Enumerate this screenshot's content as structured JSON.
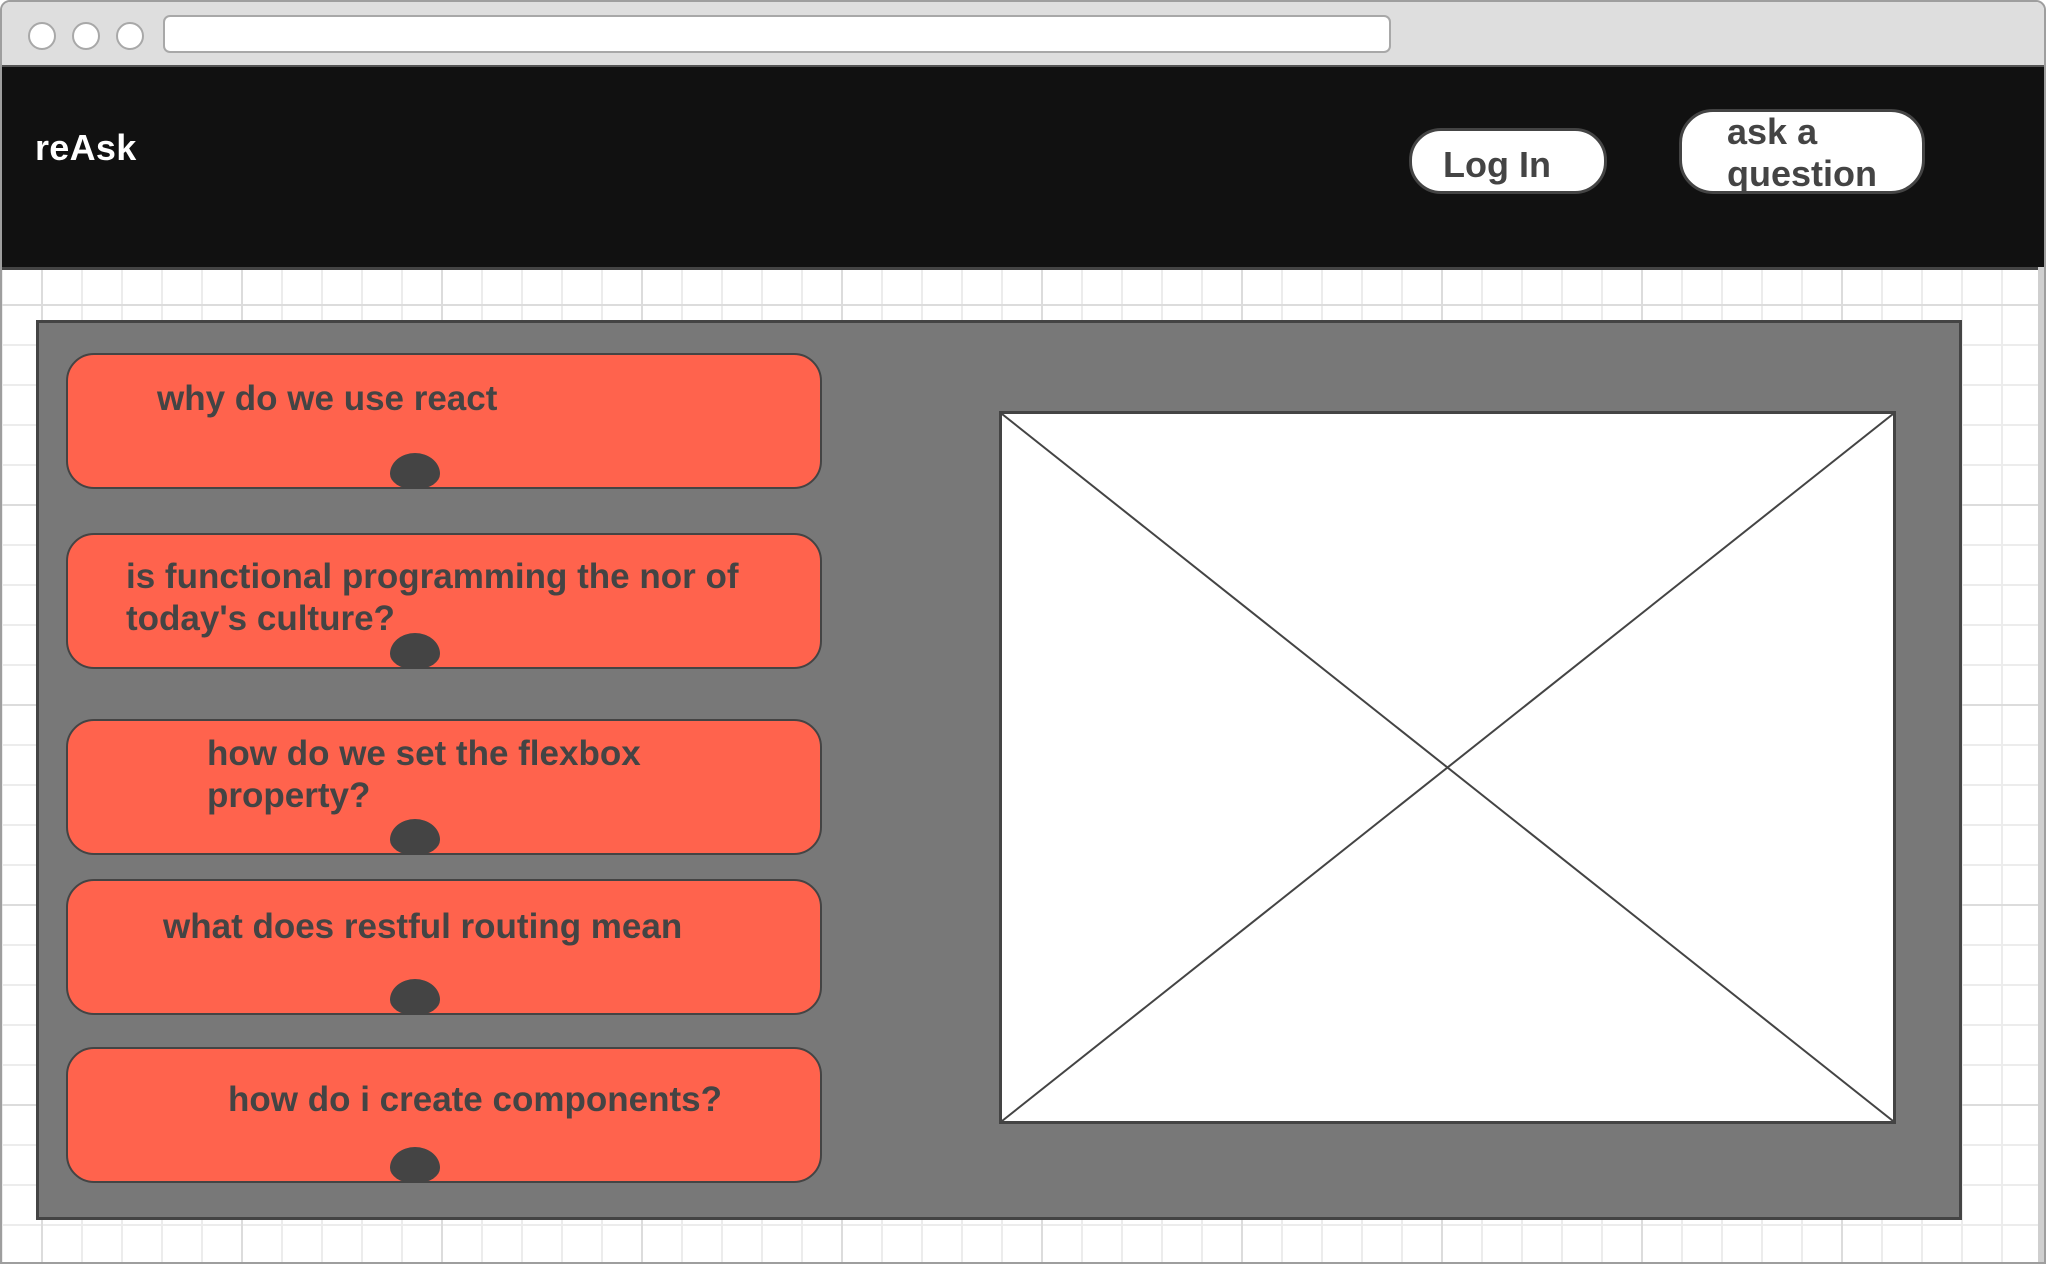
{
  "browser": {
    "address_bar": {
      "value": ""
    },
    "window_controls": [
      "close",
      "minimize",
      "maximize"
    ]
  },
  "header": {
    "brand": "reAsk",
    "login_label": "Log In",
    "ask_label": "ask a question",
    "background": "#111111"
  },
  "main": {
    "questions": [
      {
        "text": "why do we use react"
      },
      {
        "text": "is functional programming the nor of today's culture?"
      },
      {
        "text": "how do we set the flexbox property?"
      },
      {
        "text": "what does restful routing mean"
      },
      {
        "text": "how do i create components?"
      }
    ],
    "image_placeholder": {
      "icon": "image-placeholder-x-icon"
    }
  },
  "colors": {
    "card": "#ff634d",
    "panel": "#787878",
    "text": "#444444",
    "header": "#111111"
  }
}
